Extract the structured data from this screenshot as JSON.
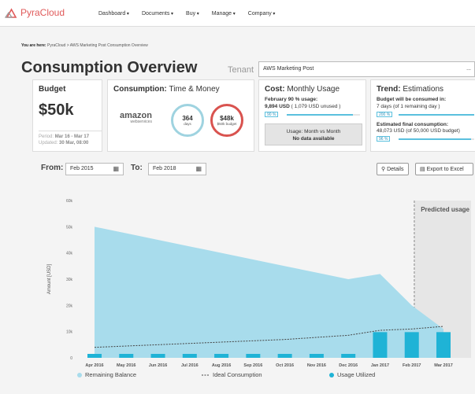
{
  "app": {
    "name": "PyraCloud"
  },
  "nav": {
    "items": [
      "Dashboard",
      "Documents",
      "Buy",
      "Manage",
      "Company"
    ]
  },
  "breadcrumb": {
    "prefix": "You are here:",
    "path": "PyraCloud > AWS Marketing Post Consumption Overview"
  },
  "page": {
    "title": "Consumption Overview"
  },
  "tenant": {
    "label": "Tenant",
    "value": "AWS Marketing Post",
    "more": "..."
  },
  "budget_card": {
    "title": "Budget",
    "value": "$50k",
    "period_label": "Period:",
    "period_value": "Mar 16 - Mar 17",
    "updated_label": "Updated:",
    "updated_value": "30 Mar, 08:00"
  },
  "consumption_card": {
    "title_bold": "Consumption:",
    "title_light": "Time & Money",
    "provider": "amazon",
    "provider_sub": "webservices",
    "days_value": "364",
    "days_label": "days",
    "money_value": "$48k",
    "money_label": "$50k budget"
  },
  "cost_card": {
    "title_bold": "Cost:",
    "title_light": "Monthly Usage",
    "line1": "February 90 % usage:",
    "line2_value": "9,894 USD",
    "line2_rest": "( 1,079 USD unused )",
    "progress_label": "90 %",
    "progress": 0.9,
    "nodata_line1": "Usage: Month vs Month",
    "nodata_line2": "No data available"
  },
  "trend_card": {
    "title_bold": "Trend:",
    "title_light": "Estimations",
    "line1": "Budget will be consumed in:",
    "line2": "7 days (of 1 remaining day )",
    "progress1_label": "200 %",
    "progress1": 1.0,
    "line3": "Estimated final consumption:",
    "line4": "48,073 USD (of 50,000 USD budget)",
    "progress2_label": "96 %",
    "progress2": 0.96
  },
  "filters": {
    "from_label": "From:",
    "from_value": "Feb 2015",
    "to_label": "To:",
    "to_value": "Feb 2018",
    "details_label": "Details",
    "export_label": "Export to Excel"
  },
  "colors": {
    "accent": "#5bc0de",
    "bar": "#1fb3d6",
    "area": "#a8dcec",
    "brand": "#e05a5a"
  },
  "chart_data": {
    "type": "area",
    "ylabel": "Amount [USD]",
    "annotation": "Predicted usage",
    "y_ticks": [
      "0",
      "10k",
      "20k",
      "30k",
      "40k",
      "50k",
      "60k"
    ],
    "ylim": [
      0,
      60000
    ],
    "categories": [
      "Apr 2016",
      "May 2016",
      "Jun 2016",
      "Jul 2016",
      "Aug 2016",
      "Sep 2016",
      "Oct 2016",
      "Nov 2016",
      "Dec 2016",
      "Jan 2017",
      "Feb 2017",
      "Mar 2017"
    ],
    "series": [
      {
        "name": "Remaining Balance",
        "values": [
          50000,
          47500,
          45000,
          42500,
          40000,
          37500,
          35000,
          32500,
          30000,
          32000,
          20000,
          11000
        ]
      },
      {
        "name": "Ideal Consumption",
        "values": [
          4000,
          4500,
          5000,
          5500,
          6000,
          6500,
          7000,
          7800,
          8600,
          10500,
          11000,
          12000
        ]
      },
      {
        "name": "Usage Utilized",
        "values": [
          1500,
          1500,
          1500,
          1500,
          1500,
          1500,
          1500,
          1500,
          1500,
          9800,
          9800,
          9800
        ]
      }
    ],
    "legend_position": "bottom",
    "grid": false
  }
}
